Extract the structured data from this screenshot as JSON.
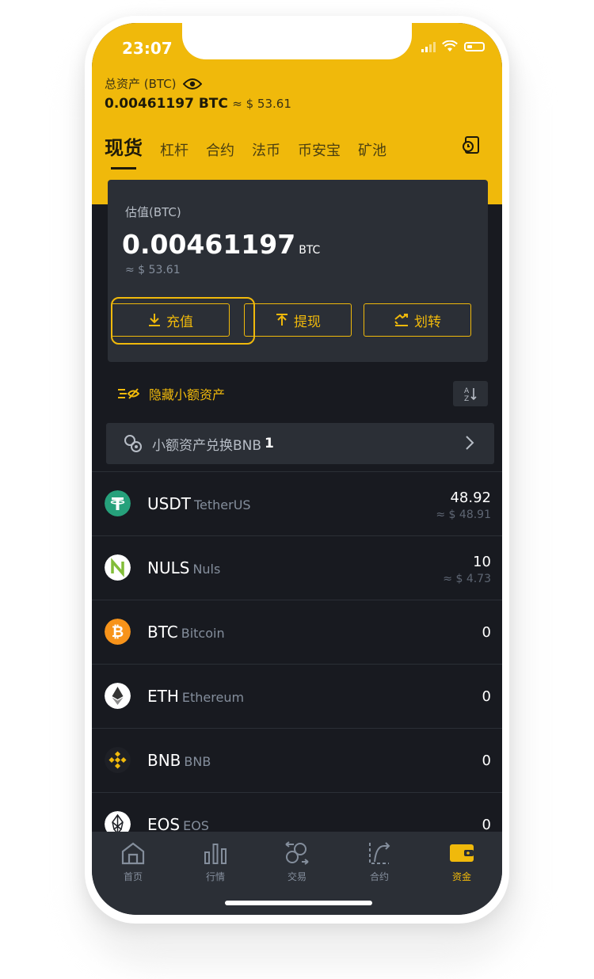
{
  "status_bar": {
    "time": "23:07"
  },
  "header": {
    "total_label": "总资产 (BTC)",
    "total_btc": "0.00461197 BTC",
    "total_usd": "≈ $  53.61",
    "tabs": [
      "现货",
      "杠杆",
      "合约",
      "法币",
      "币安宝",
      "矿池"
    ]
  },
  "card": {
    "label": "估值(BTC)",
    "value": "0.00461197",
    "unit": "BTC",
    "approx": "≈ $  53.61",
    "buttons": {
      "deposit": "充值",
      "withdraw": "提现",
      "transfer": "划转"
    }
  },
  "hide_small_label": "隐藏小额资产",
  "convert": {
    "label": "小额资产兑换BNB",
    "count": "1"
  },
  "assets": [
    {
      "symbol": "USDT",
      "name": "TetherUS",
      "amount": "48.92",
      "usd": "≈ $  48.91",
      "icon": "tether-icon",
      "color": "#26a17b"
    },
    {
      "symbol": "NULS",
      "name": "Nuls",
      "amount": "10",
      "usd": "≈ $  4.73",
      "icon": "nuls-icon",
      "color": "#ffffff"
    },
    {
      "symbol": "BTC",
      "name": "Bitcoin",
      "amount": "0",
      "usd": "",
      "icon": "bitcoin-icon",
      "color": "#f7931a"
    },
    {
      "symbol": "ETH",
      "name": "Ethereum",
      "amount": "0",
      "usd": "",
      "icon": "ethereum-icon",
      "color": "#ffffff"
    },
    {
      "symbol": "BNB",
      "name": "BNB",
      "amount": "0",
      "usd": "",
      "icon": "bnb-icon",
      "color": "#1e2026"
    },
    {
      "symbol": "EOS",
      "name": "EOS",
      "amount": "0",
      "usd": "",
      "icon": "eos-icon",
      "color": "#ffffff"
    }
  ],
  "bottom_nav": [
    "首页",
    "行情",
    "交易",
    "合约",
    "资金"
  ],
  "colors": {
    "accent": "#f0b90b",
    "bg": "#181a20",
    "card": "#2b2f36"
  }
}
